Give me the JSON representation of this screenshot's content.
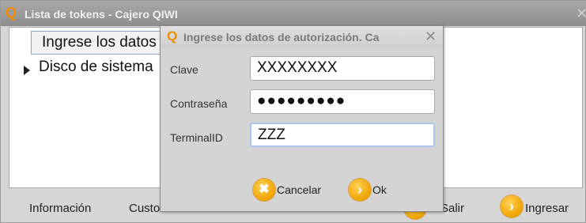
{
  "main_window": {
    "title": "Lista de tokens - Cajero QIWI",
    "tree": [
      {
        "label": "Ingrese los datos de autorización. Ca"
      },
      {
        "label": "Disco de sistema"
      }
    ],
    "bottom_buttons": [
      {
        "label": "Información"
      },
      {
        "label": "Custom"
      },
      {
        "label": "Salir"
      },
      {
        "label": "Ingresar"
      }
    ]
  },
  "dialog": {
    "title": "Ingrese los datos de autorización. Ca",
    "fields": [
      {
        "label": "Clave",
        "value": "XXXXXXXX"
      },
      {
        "label": "Contraseña",
        "value": "●●●●●●●●●"
      },
      {
        "label": "TerminalID",
        "value": "ZZZ"
      }
    ],
    "cancel_label": "Cancelar",
    "ok_label": "Ok"
  },
  "colors": {
    "accent": "#f0a200",
    "logo": "#f08c00"
  },
  "icons": {
    "logo": "qiwi-q-logo-icon",
    "close": "close-icon",
    "cancel": "x-circle-icon",
    "ok": "arrow-right-circle-icon"
  }
}
